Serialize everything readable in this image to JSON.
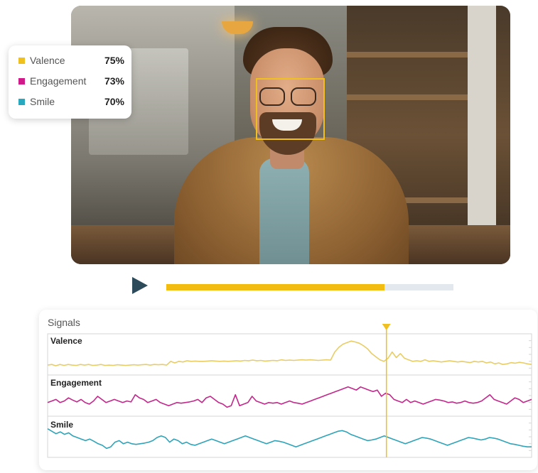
{
  "metrics": [
    {
      "label": "Valence",
      "value": "75%",
      "color": "#f0c020"
    },
    {
      "label": "Engagement",
      "value": "73%",
      "color": "#d11a8a"
    },
    {
      "label": "Smile",
      "value": "70%",
      "color": "#2aa8c0"
    }
  ],
  "player": {
    "progress": 0.76,
    "play_color": "#2c4a5a",
    "progress_color": "#f2bc10"
  },
  "signals": {
    "title": "Signals",
    "marker_position": 0.7,
    "marker_color": "#f0c020",
    "tracks": [
      {
        "label": "Valence",
        "color": "#e8cd66",
        "values": [
          0.18,
          0.2,
          0.16,
          0.2,
          0.17,
          0.2,
          0.18,
          0.17,
          0.2,
          0.18,
          0.2,
          0.17,
          0.18,
          0.2,
          0.17,
          0.18,
          0.17,
          0.19,
          0.18,
          0.17,
          0.18,
          0.19,
          0.18,
          0.19,
          0.2,
          0.18,
          0.2,
          0.19,
          0.2,
          0.18,
          0.3,
          0.25,
          0.3,
          0.28,
          0.32,
          0.3,
          0.31,
          0.3,
          0.3,
          0.31,
          0.32,
          0.31,
          0.3,
          0.31,
          0.3,
          0.31,
          0.32,
          0.31,
          0.33,
          0.32,
          0.34,
          0.32,
          0.33,
          0.31,
          0.32,
          0.33,
          0.32,
          0.35,
          0.33,
          0.34,
          0.33,
          0.34,
          0.35,
          0.34,
          0.35,
          0.34,
          0.33,
          0.34,
          0.35,
          0.34,
          0.6,
          0.75,
          0.85,
          0.9,
          0.95,
          0.92,
          0.88,
          0.8,
          0.7,
          0.55,
          0.45,
          0.35,
          0.3,
          0.4,
          0.6,
          0.42,
          0.55,
          0.4,
          0.35,
          0.3,
          0.32,
          0.3,
          0.35,
          0.3,
          0.32,
          0.3,
          0.28,
          0.3,
          0.32,
          0.3,
          0.28,
          0.3,
          0.28,
          0.26,
          0.3,
          0.28,
          0.3,
          0.25,
          0.28,
          0.22,
          0.25,
          0.2,
          0.22,
          0.26,
          0.24,
          0.27,
          0.25,
          0.22,
          0.2
        ]
      },
      {
        "label": "Engagement",
        "color": "#c2288c",
        "values": [
          0.3,
          0.35,
          0.4,
          0.3,
          0.35,
          0.45,
          0.38,
          0.32,
          0.4,
          0.3,
          0.25,
          0.35,
          0.5,
          0.4,
          0.3,
          0.35,
          0.4,
          0.35,
          0.3,
          0.35,
          0.32,
          0.55,
          0.45,
          0.4,
          0.3,
          0.35,
          0.4,
          0.3,
          0.25,
          0.2,
          0.25,
          0.3,
          0.28,
          0.3,
          0.32,
          0.35,
          0.4,
          0.3,
          0.45,
          0.5,
          0.4,
          0.3,
          0.25,
          0.15,
          0.2,
          0.55,
          0.2,
          0.25,
          0.3,
          0.5,
          0.35,
          0.3,
          0.25,
          0.3,
          0.28,
          0.3,
          0.25,
          0.3,
          0.35,
          0.3,
          0.28,
          0.25,
          0.3,
          0.35,
          0.4,
          0.45,
          0.5,
          0.55,
          0.6,
          0.65,
          0.7,
          0.75,
          0.8,
          0.75,
          0.7,
          0.8,
          0.75,
          0.7,
          0.65,
          0.7,
          0.5,
          0.6,
          0.55,
          0.4,
          0.35,
          0.3,
          0.4,
          0.3,
          0.35,
          0.3,
          0.25,
          0.3,
          0.35,
          0.4,
          0.38,
          0.35,
          0.3,
          0.32,
          0.28,
          0.3,
          0.35,
          0.3,
          0.28,
          0.3,
          0.35,
          0.45,
          0.55,
          0.4,
          0.35,
          0.3,
          0.25,
          0.35,
          0.45,
          0.4,
          0.3,
          0.35,
          0.4
        ]
      },
      {
        "label": "Smile",
        "color": "#2fa3b8",
        "values": [
          0.78,
          0.7,
          0.62,
          0.68,
          0.6,
          0.65,
          0.55,
          0.5,
          0.45,
          0.4,
          0.45,
          0.38,
          0.3,
          0.25,
          0.15,
          0.2,
          0.35,
          0.4,
          0.3,
          0.35,
          0.3,
          0.28,
          0.3,
          0.32,
          0.35,
          0.4,
          0.5,
          0.55,
          0.5,
          0.35,
          0.45,
          0.4,
          0.3,
          0.35,
          0.28,
          0.25,
          0.3,
          0.35,
          0.4,
          0.45,
          0.4,
          0.35,
          0.3,
          0.35,
          0.4,
          0.45,
          0.5,
          0.55,
          0.5,
          0.45,
          0.4,
          0.35,
          0.3,
          0.35,
          0.4,
          0.38,
          0.35,
          0.3,
          0.25,
          0.2,
          0.25,
          0.3,
          0.35,
          0.4,
          0.45,
          0.5,
          0.55,
          0.6,
          0.65,
          0.7,
          0.72,
          0.68,
          0.6,
          0.55,
          0.5,
          0.45,
          0.4,
          0.42,
          0.45,
          0.5,
          0.55,
          0.5,
          0.45,
          0.4,
          0.35,
          0.3,
          0.35,
          0.4,
          0.45,
          0.5,
          0.48,
          0.45,
          0.4,
          0.35,
          0.3,
          0.25,
          0.3,
          0.35,
          0.4,
          0.45,
          0.5,
          0.48,
          0.45,
          0.42,
          0.45,
          0.5,
          0.48,
          0.45,
          0.4,
          0.35,
          0.3,
          0.28,
          0.25,
          0.22,
          0.2,
          0.2
        ]
      }
    ]
  }
}
